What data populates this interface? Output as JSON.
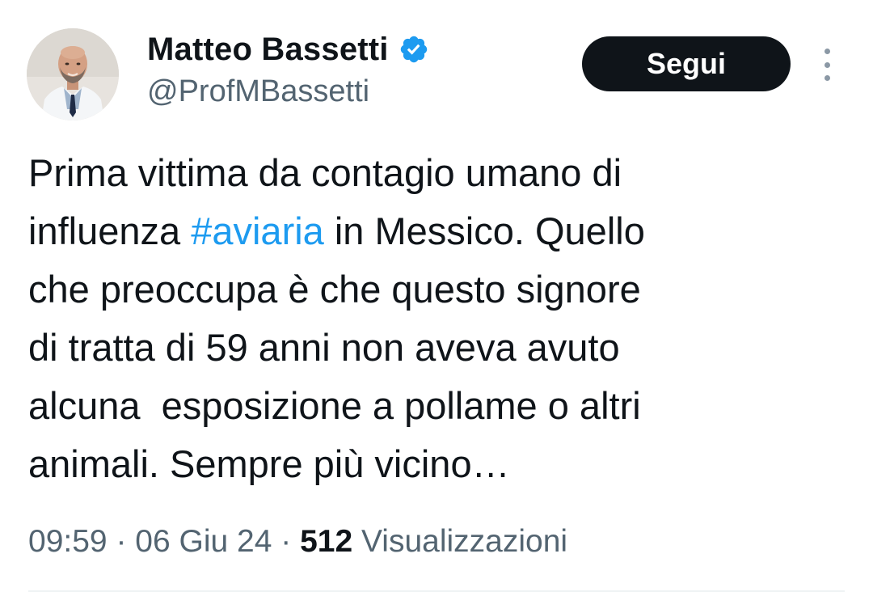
{
  "author": {
    "display_name": "Matteo Bassetti",
    "handle": "@ProfMBassetti",
    "verified_icon": "verified-badge-icon",
    "avatar_icon": "avatar-photo"
  },
  "actions": {
    "follow_label": "Segui",
    "more_icon": "more-vertical-icon"
  },
  "tweet": {
    "lines": [
      {
        "before": "Prima vittima da contagio umano di"
      },
      {
        "before": "influenza ",
        "hashtag": "#aviaria",
        "after": " in Messico. Quello"
      },
      {
        "before": "che preoccupa è che questo signore"
      },
      {
        "before": "di tratta di 59 anni non aveva avuto"
      },
      {
        "before": "alcuna  esposizione a pollame o altri"
      },
      {
        "before": "animali. Sempre più vicino…"
      }
    ]
  },
  "meta": {
    "time": "09:59",
    "separator": " · ",
    "date": "06 Giu 24",
    "views_count": "512",
    "views_label": " Visualizzazioni"
  },
  "colors": {
    "text": "#0f1419",
    "secondary": "#536471",
    "link": "#1d9bf0",
    "button_bg": "#0f1419",
    "verified": "#1d9bf0"
  }
}
